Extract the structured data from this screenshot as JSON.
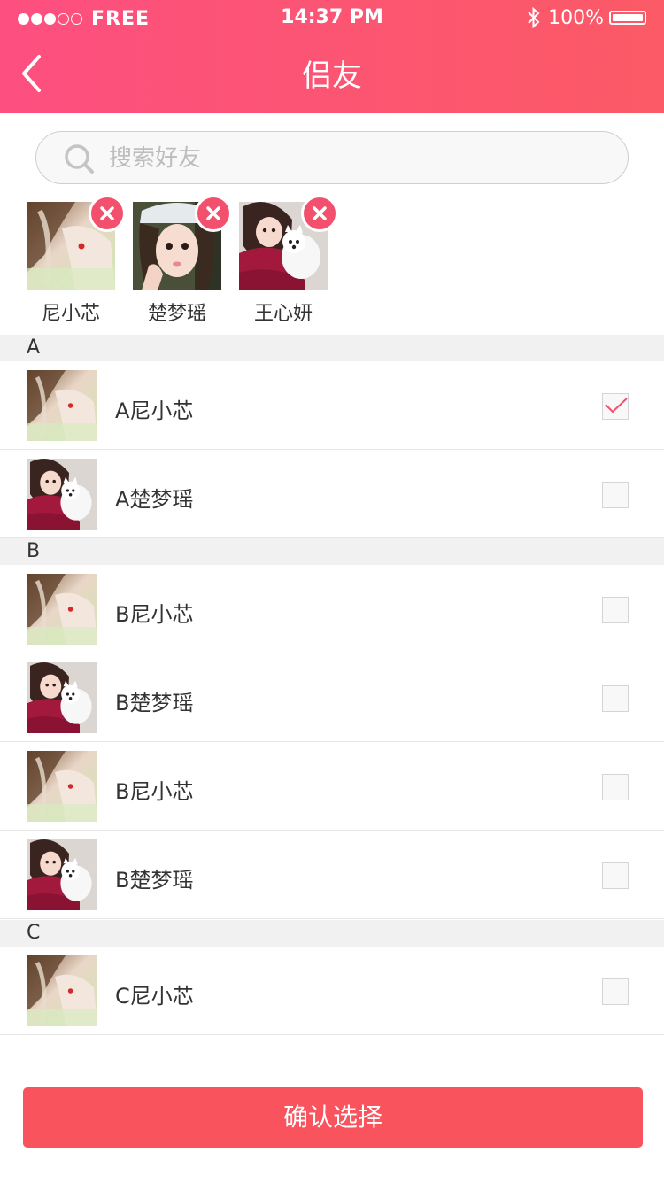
{
  "status_bar": {
    "carrier": "FREE",
    "time": "14:37 PM",
    "battery": "100%"
  },
  "header": {
    "title": "侣友"
  },
  "search": {
    "placeholder": "搜索好友"
  },
  "selected": [
    {
      "name": "尼小芯",
      "avatar": "photo-a"
    },
    {
      "name": "楚梦瑶",
      "avatar": "photo-b"
    },
    {
      "name": "王心妍",
      "avatar": "photo-c"
    }
  ],
  "sections": [
    {
      "letter": "A",
      "rows": [
        {
          "name": "A尼小芯",
          "avatar": "photo-a",
          "checked": true
        },
        {
          "name": "A楚梦瑶",
          "avatar": "photo-c",
          "checked": false
        }
      ]
    },
    {
      "letter": "B",
      "rows": [
        {
          "name": "B尼小芯",
          "avatar": "photo-a",
          "checked": false
        },
        {
          "name": "B楚梦瑶",
          "avatar": "photo-c",
          "checked": false
        },
        {
          "name": "B尼小芯",
          "avatar": "photo-a",
          "checked": false
        },
        {
          "name": "B楚梦瑶",
          "avatar": "photo-c",
          "checked": false
        }
      ]
    },
    {
      "letter": "C",
      "rows": [
        {
          "name": "C尼小芯",
          "avatar": "photo-a",
          "checked": false
        }
      ]
    }
  ],
  "confirm_label": "确认选择",
  "colors": {
    "header_start": "#fd4f80",
    "header_end": "#fb5a66",
    "accent": "#f9535e",
    "remove_badge": "#f2506c",
    "check": "#f2506c"
  }
}
